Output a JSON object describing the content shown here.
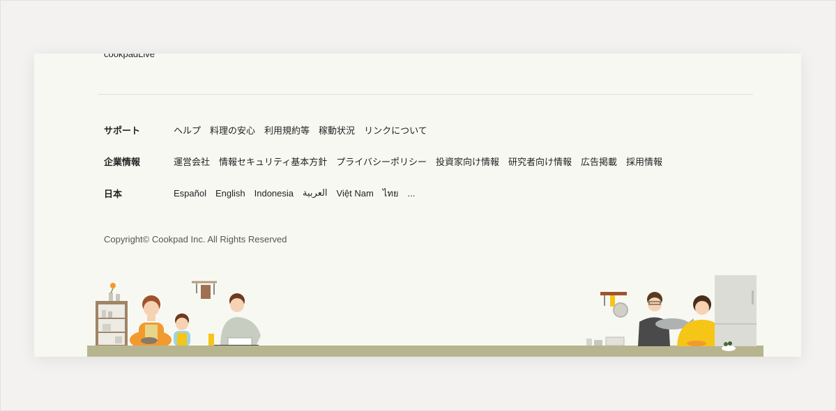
{
  "footer": {
    "cut_off_link": "cookpadLive",
    "sections": [
      {
        "title": "サポート",
        "links": [
          "ヘルプ",
          "料理の安心",
          "利用規約等",
          "稼動状況",
          "リンクについて"
        ]
      },
      {
        "title": "企業情報",
        "links": [
          "運営会社",
          "情報セキュリティ基本方針",
          "プライバシーポリシー",
          "投資家向け情報",
          "研究者向け情報",
          "広告掲載",
          "採用情報"
        ]
      },
      {
        "title": "日本",
        "links": [
          "Español",
          "English",
          "Indonesia",
          "العربية",
          "Việt Nam",
          "ไทย",
          "..."
        ]
      }
    ],
    "copyright": "Copyright© Cookpad Inc. All Rights Reserved"
  },
  "colors": {
    "page_bg": "#f3f2f0",
    "panel_bg": "#f8f8f3",
    "counter": "#b7b590",
    "accent_orange": "#f29a2e",
    "accent_yellow": "#f5c518"
  }
}
